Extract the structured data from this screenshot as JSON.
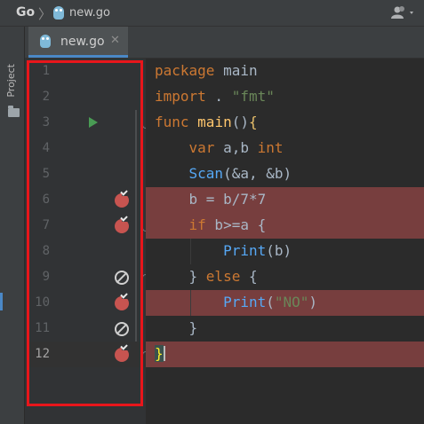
{
  "navbar": {
    "project": "Go",
    "file": "new.go",
    "icons": [
      "go-gopher-icon",
      "user-menu-icon"
    ]
  },
  "toolstrip": {
    "project_tab": "Project",
    "icons": [
      "folder-icon"
    ]
  },
  "tabs": [
    {
      "label": "new.go",
      "active": true,
      "icon": "go-gopher-icon",
      "close": "✕"
    }
  ],
  "gutter": {
    "lines": [
      {
        "n": "1",
        "marker": "none"
      },
      {
        "n": "2",
        "marker": "none"
      },
      {
        "n": "3",
        "marker": "run"
      },
      {
        "n": "4",
        "marker": "none"
      },
      {
        "n": "5",
        "marker": "none"
      },
      {
        "n": "6",
        "marker": "breakpoint"
      },
      {
        "n": "7",
        "marker": "breakpoint"
      },
      {
        "n": "8",
        "marker": "none"
      },
      {
        "n": "9",
        "marker": "breakpoint-disabled"
      },
      {
        "n": "10",
        "marker": "breakpoint"
      },
      {
        "n": "11",
        "marker": "breakpoint-disabled"
      },
      {
        "n": "12",
        "marker": "breakpoint",
        "current": true
      }
    ]
  },
  "code": {
    "lines": [
      {
        "indent": "",
        "parts": [
          [
            "kw",
            "package"
          ],
          [
            "t",
            " main"
          ]
        ]
      },
      {
        "indent": "",
        "parts": [
          [
            "kw",
            "import"
          ],
          [
            "t",
            " . "
          ],
          [
            "str",
            "\"fmt\""
          ]
        ]
      },
      {
        "indent": "",
        "parts": [
          [
            "kw",
            "func"
          ],
          [
            "t",
            " "
          ],
          [
            "fn",
            "main"
          ],
          [
            "t",
            "()"
          ],
          [
            "brace",
            "{"
          ]
        ]
      },
      {
        "indent": "    ",
        "parts": [
          [
            "kw",
            "var"
          ],
          [
            "t",
            " a,b "
          ],
          [
            "kw",
            "int"
          ]
        ]
      },
      {
        "indent": "    ",
        "parts": [
          [
            "call",
            "Scan"
          ],
          [
            "t",
            "(&a, &b)"
          ]
        ]
      },
      {
        "indent": "    ",
        "parts": [
          [
            "t",
            "b = b/7*7"
          ]
        ]
      },
      {
        "indent": "    ",
        "parts": [
          [
            "kw",
            "if"
          ],
          [
            "t",
            " b>=a {"
          ]
        ]
      },
      {
        "indent": "        ",
        "parts": [
          [
            "call",
            "Print"
          ],
          [
            "t",
            "(b)"
          ]
        ]
      },
      {
        "indent": "    ",
        "parts": [
          [
            "t",
            "} "
          ],
          [
            "kw",
            "else"
          ],
          [
            "t",
            " {"
          ]
        ]
      },
      {
        "indent": "        ",
        "parts": [
          [
            "call",
            "Print"
          ],
          [
            "t",
            "("
          ],
          [
            "str",
            "\"NO\""
          ],
          [
            "t",
            ")"
          ]
        ]
      },
      {
        "indent": "    ",
        "parts": [
          [
            "t",
            "}"
          ]
        ]
      },
      {
        "indent": "",
        "parts": [
          [
            "brace-match",
            "}"
          ]
        ]
      }
    ]
  },
  "colors": {
    "breakpoint_line": "#773e3e",
    "breakpoint_icon": "#c75450",
    "run_icon": "#499c54",
    "annotation_box": "#e8161b",
    "keyword": "#cc7832",
    "string": "#6a8759"
  }
}
